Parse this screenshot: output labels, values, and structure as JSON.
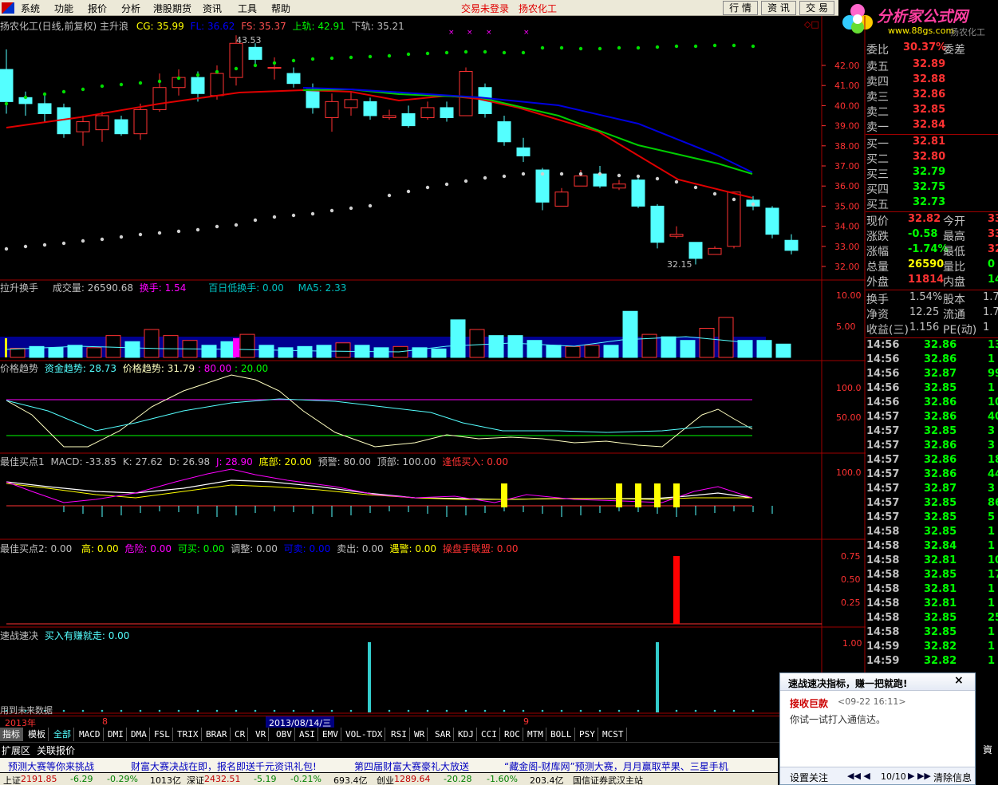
{
  "menu": {
    "items": [
      "系统",
      "功能",
      "报价",
      "分析",
      "港股期货",
      "资讯",
      "工具",
      "帮助"
    ],
    "login": "交易未登录",
    "stock": "扬农化工",
    "buttons": [
      "行 情",
      "资 讯",
      "交 易"
    ]
  },
  "logo": {
    "text": "分析家公式网",
    "url_text": "www.88gs.com",
    "extra": "扬农化工"
  },
  "main_header": {
    "title": "扬农化工(日线,前复权) 主升浪",
    "cg": "CG: 35.99",
    "fl": "FL: 36.62",
    "fs": "FS: 35.37",
    "up": "上轨: 42.91",
    "down": "下轨: 35.21",
    "high_label": "43.53",
    "low_label": "32.15"
  },
  "main_axis": [
    "42.00",
    "41.00",
    "40.00",
    "39.00",
    "38.00",
    "37.00",
    "36.00",
    "35.00",
    "34.00",
    "33.00",
    "32.00"
  ],
  "vol_header": {
    "name": "拉升换手",
    "vol": "成交量: 26590.68",
    "turn": "换手: 1.54",
    "low": "百日低换手: 0.00",
    "ma": "MA5: 2.33"
  },
  "vol_axis": [
    "10.00",
    "5.00"
  ],
  "trend_header": {
    "name": "价格趋势",
    "fund": "资金趋势: 28.73",
    "price": "价格趋势: 31.79",
    "v1": ": 80.00",
    "v2": ": 20.00"
  },
  "trend_axis": [
    "100.0",
    "50.00"
  ],
  "buy1_header": {
    "name": "最佳买点1",
    "macd": "MACD: -33.85",
    "k": "K: 27.62",
    "d": "D: 26.98",
    "j": "J: 28.90",
    "bottom": "底部: 20.00",
    "warn": "预警: 80.00",
    "top": "顶部: 100.00",
    "dip": "逢低买入: 0.00"
  },
  "buy1_axis": [
    "100.0"
  ],
  "buy2_header": {
    "name": "最佳买点2",
    "v": ": 0.00",
    "high": "高: 0.00",
    "danger": "危险: 0.00",
    "canbuy": "可买: 0.00",
    "adjust": "调整: 0.00",
    "cansell": "可卖: 0.00",
    "sell": "卖出: 0.00",
    "alarm": "遇警: 0.00",
    "union": "操盘手联盟: 0.00"
  },
  "buy2_axis": [
    "0.75",
    "0.50",
    "0.25"
  ],
  "fast_header": {
    "name": "速战速决",
    "buy": "买入有赚就走: 0.00"
  },
  "fast_axis": [
    "1.00"
  ],
  "future_text": "用到未来数据",
  "timeline": {
    "year": "2013年",
    "m8": "8",
    "date": "2013/08/14/三",
    "m9": "9"
  },
  "tabs": [
    "指标",
    "模板",
    "全部",
    "MACD",
    "DMI",
    "DMA",
    "FSL",
    "TRIX",
    "BRAR",
    "CR",
    "VR",
    "OBV",
    "ASI",
    "EMV",
    "VOL-TDX",
    "RSI",
    "WR",
    "SAR",
    "KDJ",
    "CCI",
    "ROC",
    "MTM",
    "BOLL",
    "PSY",
    "MCST"
  ],
  "subtabs": [
    "扩展区",
    "关联报价"
  ],
  "side": {
    "ratio_label": "委比",
    "ratio_value": "30.37%",
    "diff_label": "委差",
    "asks": [
      {
        "l": "卖五",
        "p": "32.89"
      },
      {
        "l": "卖四",
        "p": "32.88"
      },
      {
        "l": "卖三",
        "p": "32.86"
      },
      {
        "l": "卖二",
        "p": "32.85"
      },
      {
        "l": "卖一",
        "p": "32.84"
      }
    ],
    "bids": [
      {
        "l": "买一",
        "p": "32.81"
      },
      {
        "l": "买二",
        "p": "32.80"
      },
      {
        "l": "买三",
        "p": "32.79"
      },
      {
        "l": "买四",
        "p": "32.75"
      },
      {
        "l": "买五",
        "p": "32.73"
      }
    ],
    "quote": [
      {
        "l1": "现价",
        "v1": "32.82",
        "l2": "今开",
        "v2": "33"
      },
      {
        "l1": "涨跌",
        "v1": "-0.58",
        "l2": "最高",
        "v2": "33"
      },
      {
        "l1": "涨幅",
        "v1": "-1.74%",
        "l2": "最低",
        "v2": "32"
      },
      {
        "l1": "总量",
        "v1": "26590",
        "l2": "量比",
        "v2": "0"
      },
      {
        "l1": "外盘",
        "v1": "11814",
        "l2": "内盘",
        "v2": "14"
      }
    ],
    "info": [
      {
        "l1": "换手",
        "v1": "1.54%",
        "l2": "股本",
        "v2": "1.7"
      },
      {
        "l1": "净资",
        "v1": "12.25",
        "l2": "流通",
        "v2": "1.7"
      },
      {
        "l1": "收益(三)",
        "v1": "1.156",
        "l2": "PE(动)",
        "v2": "1"
      }
    ],
    "trades": [
      {
        "t": "14:56",
        "p": "32.86",
        "v": "13"
      },
      {
        "t": "14:56",
        "p": "32.86",
        "v": "1"
      },
      {
        "t": "14:56",
        "p": "32.87",
        "v": "99"
      },
      {
        "t": "14:56",
        "p": "32.85",
        "v": "1"
      },
      {
        "t": "14:56",
        "p": "32.86",
        "v": "10"
      },
      {
        "t": "14:57",
        "p": "32.86",
        "v": "40"
      },
      {
        "t": "14:57",
        "p": "32.85",
        "v": "3"
      },
      {
        "t": "14:57",
        "p": "32.86",
        "v": "3"
      },
      {
        "t": "14:57",
        "p": "32.86",
        "v": "18"
      },
      {
        "t": "14:57",
        "p": "32.86",
        "v": "44"
      },
      {
        "t": "14:57",
        "p": "32.87",
        "v": "3"
      },
      {
        "t": "14:57",
        "p": "32.85",
        "v": "86"
      },
      {
        "t": "14:57",
        "p": "32.85",
        "v": "5"
      },
      {
        "t": "14:58",
        "p": "32.85",
        "v": "1"
      },
      {
        "t": "14:58",
        "p": "32.84",
        "v": "1"
      },
      {
        "t": "14:58",
        "p": "32.81",
        "v": "10"
      },
      {
        "t": "14:58",
        "p": "32.85",
        "v": "17"
      },
      {
        "t": "14:58",
        "p": "32.81",
        "v": "1"
      },
      {
        "t": "14:58",
        "p": "32.81",
        "v": "1"
      },
      {
        "t": "14:58",
        "p": "32.85",
        "v": "25"
      },
      {
        "t": "14:58",
        "p": "32.85",
        "v": "1"
      },
      {
        "t": "14:59",
        "p": "32.82",
        "v": "1"
      },
      {
        "t": "14:59",
        "p": "32.82",
        "v": "1"
      }
    ]
  },
  "ticker": [
    "预测大赛等你来挑战",
    "财富大赛决战在即，报名即送千元资讯礼包!",
    "第四届财富大赛豪礼大放送",
    "“藏金阁-财库网”预测大赛，月月赢取苹果、三星手机"
  ],
  "status": [
    "上证",
    "2191.85",
    "-6.29",
    "-0.29%",
    "1013亿",
    "深证",
    "2432.51",
    "-5.19",
    "-0.21%",
    "693.4亿",
    "创业",
    "1289.64",
    "-20.28",
    "-1.60%",
    "203.4亿",
    "国信证券武汉主站"
  ],
  "popup": {
    "title": "速战速决指标，赚一把就跑!",
    "close": "×",
    "sender": "接收巨款",
    "time": "<09-22 16:11>",
    "msg": "你试一试打入通信达。",
    "settings": "设置关注",
    "pager": "10/10",
    "clear": "清除信息"
  },
  "colors": {
    "up": "#ff3232",
    "down": "#54ffff",
    "bg": "#000000",
    "frame": "#a00000"
  }
}
